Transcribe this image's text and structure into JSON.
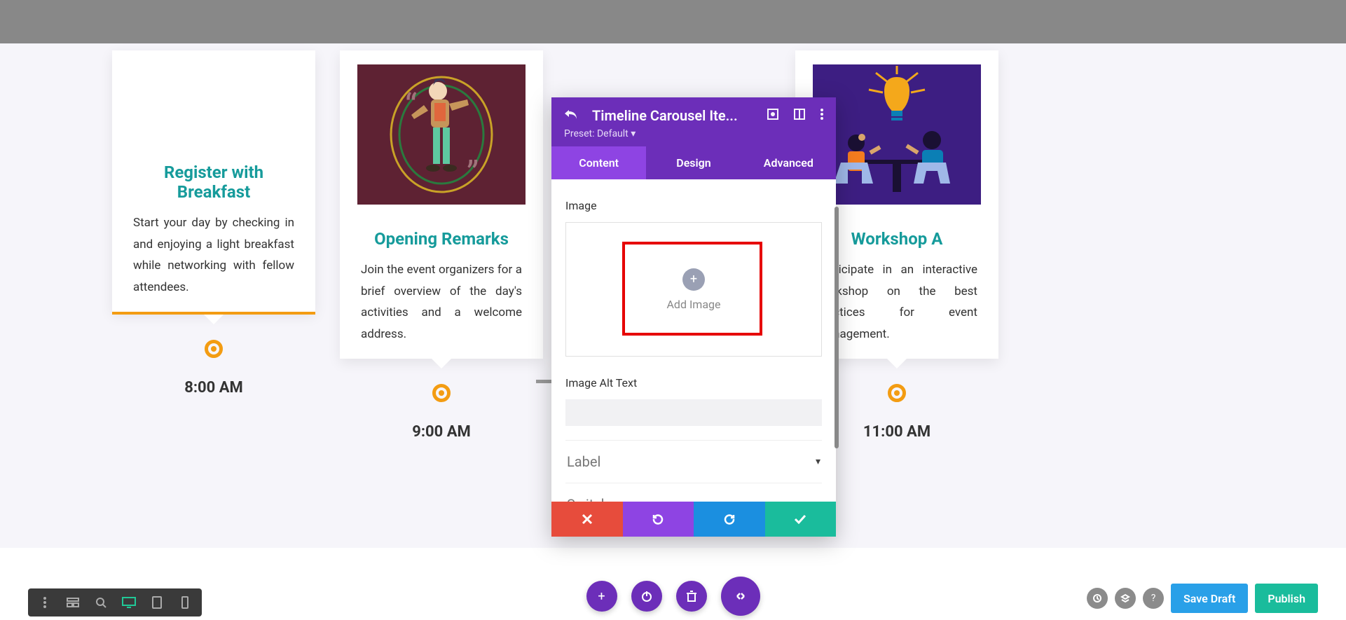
{
  "cards": [
    {
      "title": "Register with Breakfast",
      "body": "Start your day by checking in and enjoying a light breakfast while networking with fellow attendees.",
      "time": "8:00 AM"
    },
    {
      "title": "Opening Remarks",
      "body": "Join the event organizers for a brief overview of the day's activities and a welcome address.",
      "time": "9:00 AM"
    },
    {
      "title": "",
      "body": "",
      "time": ""
    },
    {
      "title": "Workshop A",
      "body": "Participate in an interactive workshop on the best practices for event management.",
      "time": "11:00 AM"
    }
  ],
  "modal": {
    "title": "Timeline Carousel Ite...",
    "preset": "Preset: Default ▾",
    "tabs": {
      "content": "Content",
      "design": "Design",
      "advanced": "Advanced"
    },
    "image_label": "Image",
    "add_image": "Add Image",
    "alt_label": "Image Alt Text",
    "accordion": {
      "label": "Label",
      "switch": "Switch"
    }
  },
  "footer": {
    "save_draft": "Save Draft",
    "publish": "Publish"
  }
}
